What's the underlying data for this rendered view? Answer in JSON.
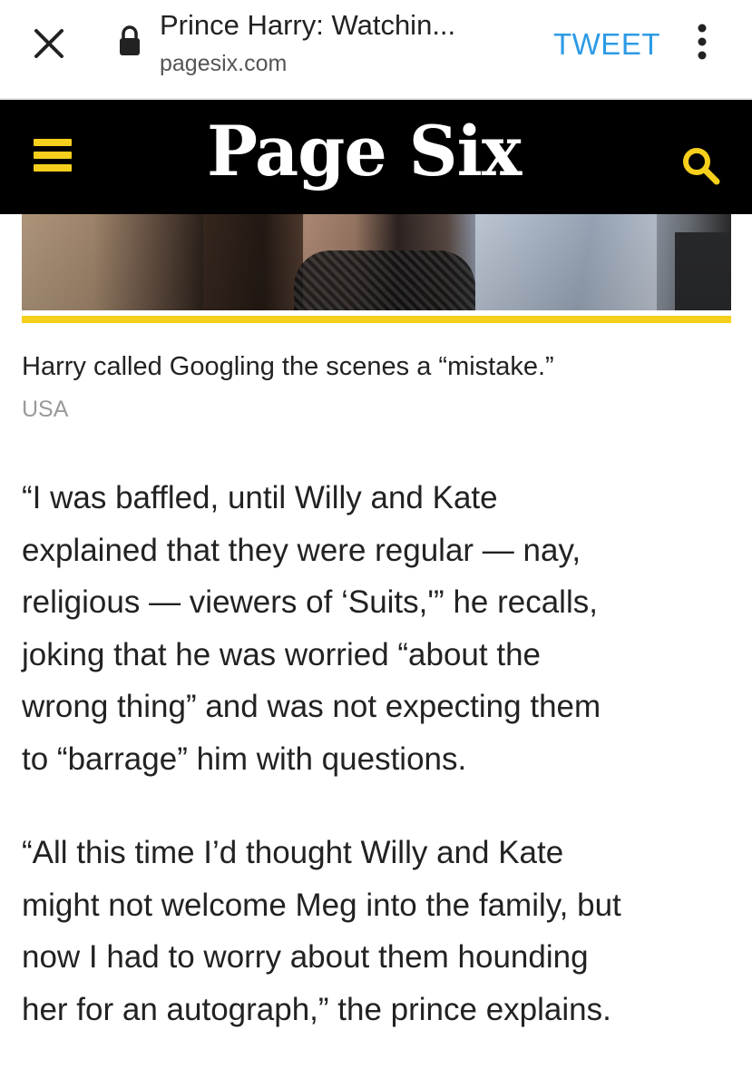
{
  "browser": {
    "tab_title": "Prince Harry: Watchin...",
    "url": "pagesix.com",
    "tweet_label": "TWEET"
  },
  "site": {
    "logo": "Page Six"
  },
  "article": {
    "caption": "Harry called Googling the scenes a “mistake.”",
    "credit": "USA",
    "paragraphs": [
      [
        "“I was baffled, until Willy and Kate",
        "explained that they were regular — nay,",
        "religious — viewers of ‘Suits,'” he recalls,",
        "joking that he was worried “about the",
        "wrong thing” and was not expecting them",
        "to “barrage” him with questions."
      ],
      [
        "“All this time I’d thought Willy and Kate",
        "might not welcome Meg into the family, but",
        "now I had to worry about them hounding",
        "her for an autograph,” the prince explains."
      ]
    ]
  },
  "colors": {
    "accent_yellow": "#f5cf1b",
    "tweet_blue": "#2b9be6",
    "header_black": "#000000"
  },
  "icons": {
    "close": "close-icon",
    "lock": "lock-icon",
    "more": "more-vertical-icon",
    "menu": "hamburger-menu-icon",
    "search": "search-icon"
  }
}
